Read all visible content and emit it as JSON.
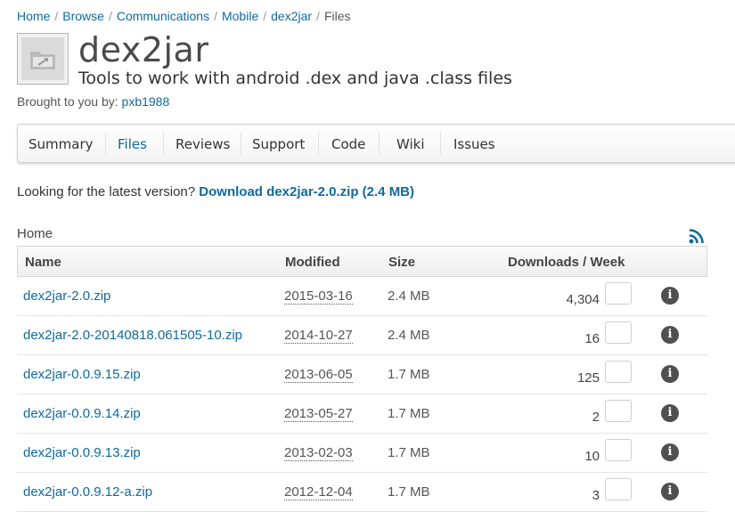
{
  "breadcrumb": {
    "items": [
      "Home",
      "Browse",
      "Communications",
      "Mobile",
      "dex2jar"
    ],
    "separator": "/",
    "current": "Files"
  },
  "project": {
    "name": "dex2jar",
    "tagline": "Tools to work with android .dex and java .class files",
    "brought_by_label": "Brought to you by:",
    "author": "pxb1988"
  },
  "tabs": [
    {
      "label": "Summary",
      "active": false
    },
    {
      "label": "Files",
      "active": true
    },
    {
      "label": "Reviews",
      "active": false
    },
    {
      "label": "Support",
      "active": false
    },
    {
      "label": "Code",
      "active": false
    },
    {
      "label": "Wiki",
      "active": false
    },
    {
      "label": "Issues",
      "active": false
    }
  ],
  "latest": {
    "prompt": "Looking for the latest version?",
    "link": "Download dex2jar-2.0.zip (2.4 MB)"
  },
  "directory": {
    "label": "Home",
    "rss_icon": "rss-feed-icon"
  },
  "table": {
    "headers": {
      "name": "Name",
      "modified": "Modified",
      "size": "Size",
      "downloads": "Downloads / Week"
    },
    "info_icon": "info-icon",
    "rows": [
      {
        "name": "dex2jar-2.0.zip",
        "modified": "2015-03-16",
        "size": "2.4 MB",
        "downloads": "4,304"
      },
      {
        "name": "dex2jar-2.0-20140818.061505-10.zip",
        "modified": "2014-10-27",
        "size": "2.4 MB",
        "downloads": "16"
      },
      {
        "name": "dex2jar-0.0.9.15.zip",
        "modified": "2013-06-05",
        "size": "1.7 MB",
        "downloads": "125"
      },
      {
        "name": "dex2jar-0.0.9.14.zip",
        "modified": "2013-05-27",
        "size": "1.7 MB",
        "downloads": "2"
      },
      {
        "name": "dex2jar-0.0.9.13.zip",
        "modified": "2013-02-03",
        "size": "1.7 MB",
        "downloads": "10"
      },
      {
        "name": "dex2jar-0.0.9.12-a.zip",
        "modified": "2012-12-04",
        "size": "1.7 MB",
        "downloads": "3"
      }
    ]
  },
  "colors": {
    "link": "#0e6a9e",
    "info_icon_bg": "#505050"
  }
}
